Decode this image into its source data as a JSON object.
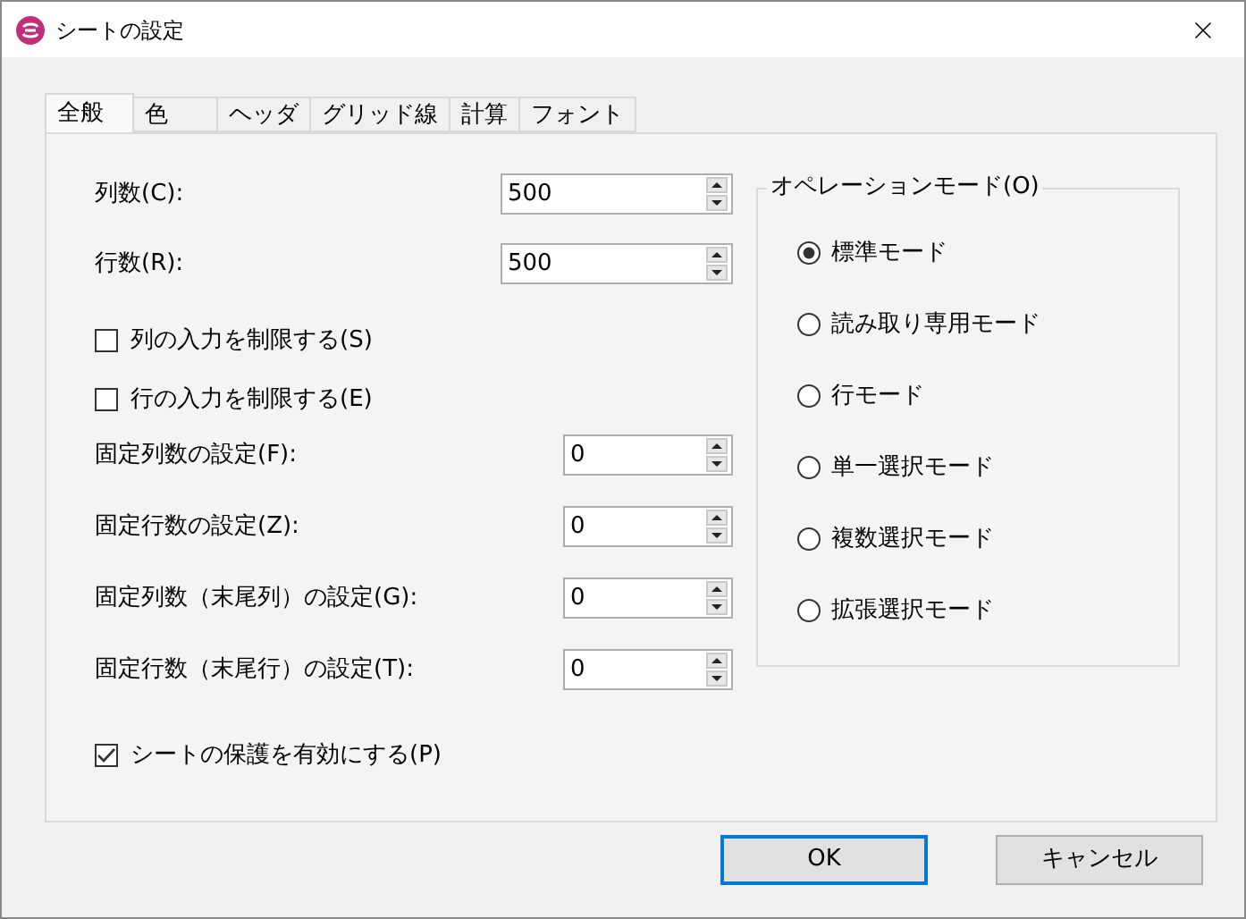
{
  "window": {
    "title": "シートの設定"
  },
  "tabs": [
    {
      "label": "全般",
      "selected": true
    },
    {
      "label": "色",
      "selected": false
    },
    {
      "label": "ヘッダ",
      "selected": false
    },
    {
      "label": "グリッド線",
      "selected": false
    },
    {
      "label": "計算",
      "selected": false
    },
    {
      "label": "フォント",
      "selected": false
    }
  ],
  "size_fields": [
    {
      "label": "列数(C):",
      "value": "500"
    },
    {
      "label": "行数(R):",
      "value": "500"
    }
  ],
  "restrictions": [
    {
      "label": "列の入力を制限する(S)",
      "checked": false
    },
    {
      "label": "行の入力を制限する(E)",
      "checked": false
    }
  ],
  "frozen_fields": [
    {
      "label": "固定列数の設定(F):",
      "value": "0"
    },
    {
      "label": "固定行数の設定(Z):",
      "value": "0"
    },
    {
      "label": "固定列数（末尾列）の設定(G):",
      "value": "0"
    },
    {
      "label": "固定行数（末尾行）の設定(T):",
      "value": "0"
    }
  ],
  "protection": {
    "label": "シートの保護を有効にする(P)",
    "checked": true
  },
  "operation_mode": {
    "legend": "オペレーションモード(O)",
    "options": [
      {
        "label": "標準モード",
        "selected": true
      },
      {
        "label": "読み取り専用モード",
        "selected": false
      },
      {
        "label": "行モード",
        "selected": false
      },
      {
        "label": "単一選択モード",
        "selected": false
      },
      {
        "label": "複数選択モード",
        "selected": false
      },
      {
        "label": "拡張選択モード",
        "selected": false
      }
    ]
  },
  "buttons": [
    {
      "label": "OK",
      "default": true
    },
    {
      "label": "キャンセル",
      "default": false
    }
  ]
}
